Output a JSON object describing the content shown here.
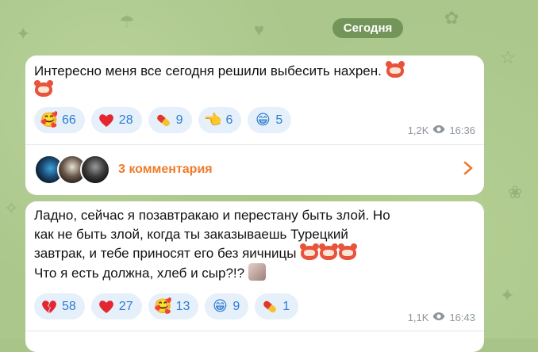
{
  "date_label": "Сегодня",
  "messages": [
    {
      "text_line1": "Интересно меня все сегодня решили выбесить нахрен.",
      "reactions": [
        {
          "icon": "smiling-face-with-hearts",
          "count": "66"
        },
        {
          "icon": "red-heart",
          "count": "28"
        },
        {
          "icon": "pill",
          "count": "9"
        },
        {
          "icon": "pointing-hand",
          "count": "6"
        },
        {
          "icon": "grinning-face",
          "count": "5"
        }
      ],
      "views": "1,2K",
      "time": "16:36",
      "comments_label": "3 комментария"
    },
    {
      "text_lines": [
        "Ладно, сейчас я позавтракаю и перестану быть злой. Но",
        "как не быть злой, когда ты заказываешь Турецкий",
        "завтрак, и тебе приносят его без яичницы"
      ],
      "text_line4": "Что я есть должна, хлеб и сыр?!?",
      "reactions": [
        {
          "icon": "broken-heart",
          "count": "58"
        },
        {
          "icon": "red-heart",
          "count": "27"
        },
        {
          "icon": "smiling-face-with-hearts",
          "count": "13"
        },
        {
          "icon": "grinning-face",
          "count": "9"
        },
        {
          "icon": "pill",
          "count": "1"
        }
      ],
      "views": "1,1K",
      "time": "16:43"
    }
  ],
  "colors": {
    "accent_blue": "#2e7dd2",
    "comments_orange": "#f07a2b",
    "background_green": "#abc78b"
  }
}
